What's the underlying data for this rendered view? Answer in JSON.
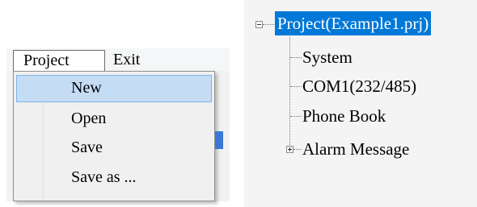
{
  "menubar": {
    "project_label": "Project",
    "exit_label": "Exit"
  },
  "project_menu": {
    "items": [
      {
        "label": "New",
        "selected": true
      },
      {
        "label": "Open",
        "selected": false
      },
      {
        "label": "Save",
        "selected": false
      },
      {
        "label": "Save as ...",
        "selected": false
      }
    ]
  },
  "tree": {
    "root": {
      "label": "Project(Example1.prj)",
      "expanded": true,
      "selected": true
    },
    "children": [
      {
        "label": "System"
      },
      {
        "label": "COM1(232/485)"
      },
      {
        "label": "Phone Book"
      },
      {
        "label": "Alarm Message",
        "collapsed": true
      }
    ]
  },
  "colors": {
    "selection_blue": "#0078d7",
    "menu_highlight": "#c5dcf5"
  }
}
